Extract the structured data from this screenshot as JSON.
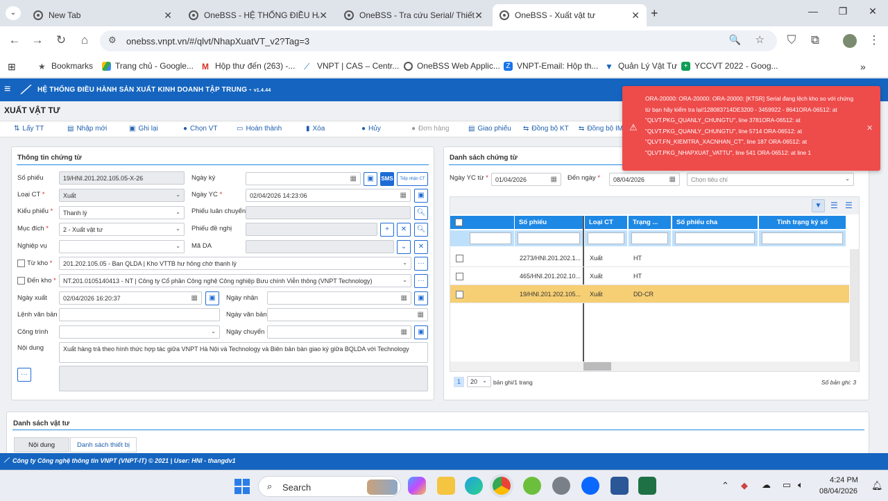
{
  "browser": {
    "tabs": [
      {
        "title": "New Tab"
      },
      {
        "title": "OneBSS - HỆ THỐNG ĐIỀU HÀNH"
      },
      {
        "title": "OneBSS - Tra cứu Serial/ Thiết bị"
      },
      {
        "title": "OneBSS - Xuất vật tư"
      }
    ],
    "url": "onebss.vnpt.vn/#/qlvt/NhapXuatVT_v2?Tag=3",
    "bookmarks": [
      "Bookmarks",
      "Trang chủ - Google...",
      "Hộp thư đến (263) -...",
      "VNPT | CAS – Centr...",
      "OneBSS Web Applic...",
      "VNPT-Email: Hộp th...",
      "Quản Lý Vật Tư",
      "YCCVT 2022 - Goog..."
    ]
  },
  "app": {
    "header": "HỆ THỐNG ĐIỀU HÀNH SẢN XUẤT KINH DOANH TẬP TRUNG -",
    "version": "v1.4.44",
    "page_title": "XUẤT VẬT TƯ",
    "actions": [
      "Lấy TT",
      "Nhập mới",
      "Ghi lại",
      "Chọn VT",
      "Hoàn thành",
      "Xóa",
      "Hủy",
      "Đơn hàng",
      "Giao phiếu",
      "Đồng bộ KT",
      "Đồng bộ IMS"
    ]
  },
  "form": {
    "title": "Thông tin chứng từ",
    "so_phieu": {
      "label": "Số phiếu",
      "value": "19/HNI.201.202.105.05-X-26"
    },
    "ngay_ky": {
      "label": "Ngày ký",
      "value": ""
    },
    "sms": "SMS",
    "tiep_nhan": "Tiếp nhận CT",
    "loai_ct": {
      "label": "Loại CT",
      "value": "Xuất"
    },
    "ngay_yc": {
      "label": "Ngày YC",
      "value": "02/04/2026 14:23:06"
    },
    "kieu_phieu": {
      "label": "Kiểu phiếu",
      "value": "Thanh lý"
    },
    "phieu_luan_chuyen": {
      "label": "Phiếu luân chuyển"
    },
    "muc_dich": {
      "label": "Mục đích",
      "value": "2 - Xuất vật tư"
    },
    "phieu_de_nghi": {
      "label": "Phiếu đề nghị"
    },
    "nghiep_vu": {
      "label": "Nghiệp vụ",
      "value": ""
    },
    "ma_da": {
      "label": "Mã DA"
    },
    "tu_kho": {
      "label": "Từ kho",
      "value": "201.202.105.05 - Ban QLDA | Kho VTTB hư hỏng chờ thanh lý"
    },
    "den_kho": {
      "label": "Đến kho",
      "value": "NT.201.0105140413 - NT | Công ty Cổ phần Công nghệ Công nghiệp Bưu chính Viễn thông (VNPT Technology)"
    },
    "ngay_xuat": {
      "label": "Ngày xuất",
      "value": "02/04/2026 16:20:37"
    },
    "ngay_nhan": {
      "label": "Ngày nhận"
    },
    "lenh_van_ban": {
      "label": "Lệnh văn bản"
    },
    "ngay_van_ban": {
      "label": "Ngày văn bản"
    },
    "cong_trinh": {
      "label": "Công trình"
    },
    "ngay_chuyen": {
      "label": "Ngày chuyển"
    },
    "noi_dung": {
      "label": "Nội dung",
      "value": "Xuất hàng trả theo hình thức hợp tác giữa VNPT Hà Nội và Technology và Biên bản bàn giao ký giữa BQLDA với Technology"
    }
  },
  "list": {
    "title": "Danh sách chứng từ",
    "ngay_yc_tu": {
      "label": "Ngày YC từ",
      "value": "01/04/2026"
    },
    "den_ngay": {
      "label": "Đến ngày",
      "value": "08/04/2026"
    },
    "tieu_chi": {
      "placeholder": "Chọn tiêu chí"
    },
    "columns": [
      "Số phiếu",
      "Loại CT",
      "Trạng ...",
      "Số phiếu cha",
      "Tình trạng ký số"
    ],
    "rows": [
      {
        "so_phieu": "2273/HNI.201.202.1...",
        "loai": "Xuất",
        "trang_thai": "HT"
      },
      {
        "so_phieu": "465/HNI.201.202.10...",
        "loai": "Xuất",
        "trang_thai": "HT"
      },
      {
        "so_phieu": "19/HNI.201.202.105...",
        "loai": "Xuất",
        "trang_thai": "DD-CR"
      }
    ],
    "page": "1",
    "page_size": "20",
    "page_info": "bản ghi/1 trang",
    "total": "Số bản ghi: 3"
  },
  "materials": {
    "title": "Danh sách vật tư",
    "tabs": [
      "Nội dung",
      "Danh sách thiết bị"
    ]
  },
  "error": {
    "message": "ORA-20000: ORA-20000: ORA-20000: [KTSR] Serial đang lệch kho so với chứng từ bạn hãy kiểm tra lại!128083714DE3200 - 3459922 - 8641ORA-06512: at \"QLVT.PKG_QUANLY_CHUNGTU\", line 3781ORA-06512: at \"QLVT.PKG_QUANLY_CHUNGTU\", line 5714 ORA-06512: at \"QLVT.FN_KIEMTRA_XACNHAN_CT\", line 187 ORA-06512: at \"QLVT.PKG_NHAPXUAT_VATTU\", line 541 ORA-06512: at line 1"
  },
  "footer": {
    "text": "Công ty Công nghệ thông tin VNPT (VNPT-IT) © 2021 | User: HNI - thangdv1"
  },
  "taskbar": {
    "search": "Search",
    "time": "4:24 PM",
    "date": "08/04/2026"
  },
  "colors": {
    "brand": "#1565c0",
    "accent": "#1e88e5",
    "error": "#ee4b4b",
    "selected_row": "#f6cf74"
  }
}
